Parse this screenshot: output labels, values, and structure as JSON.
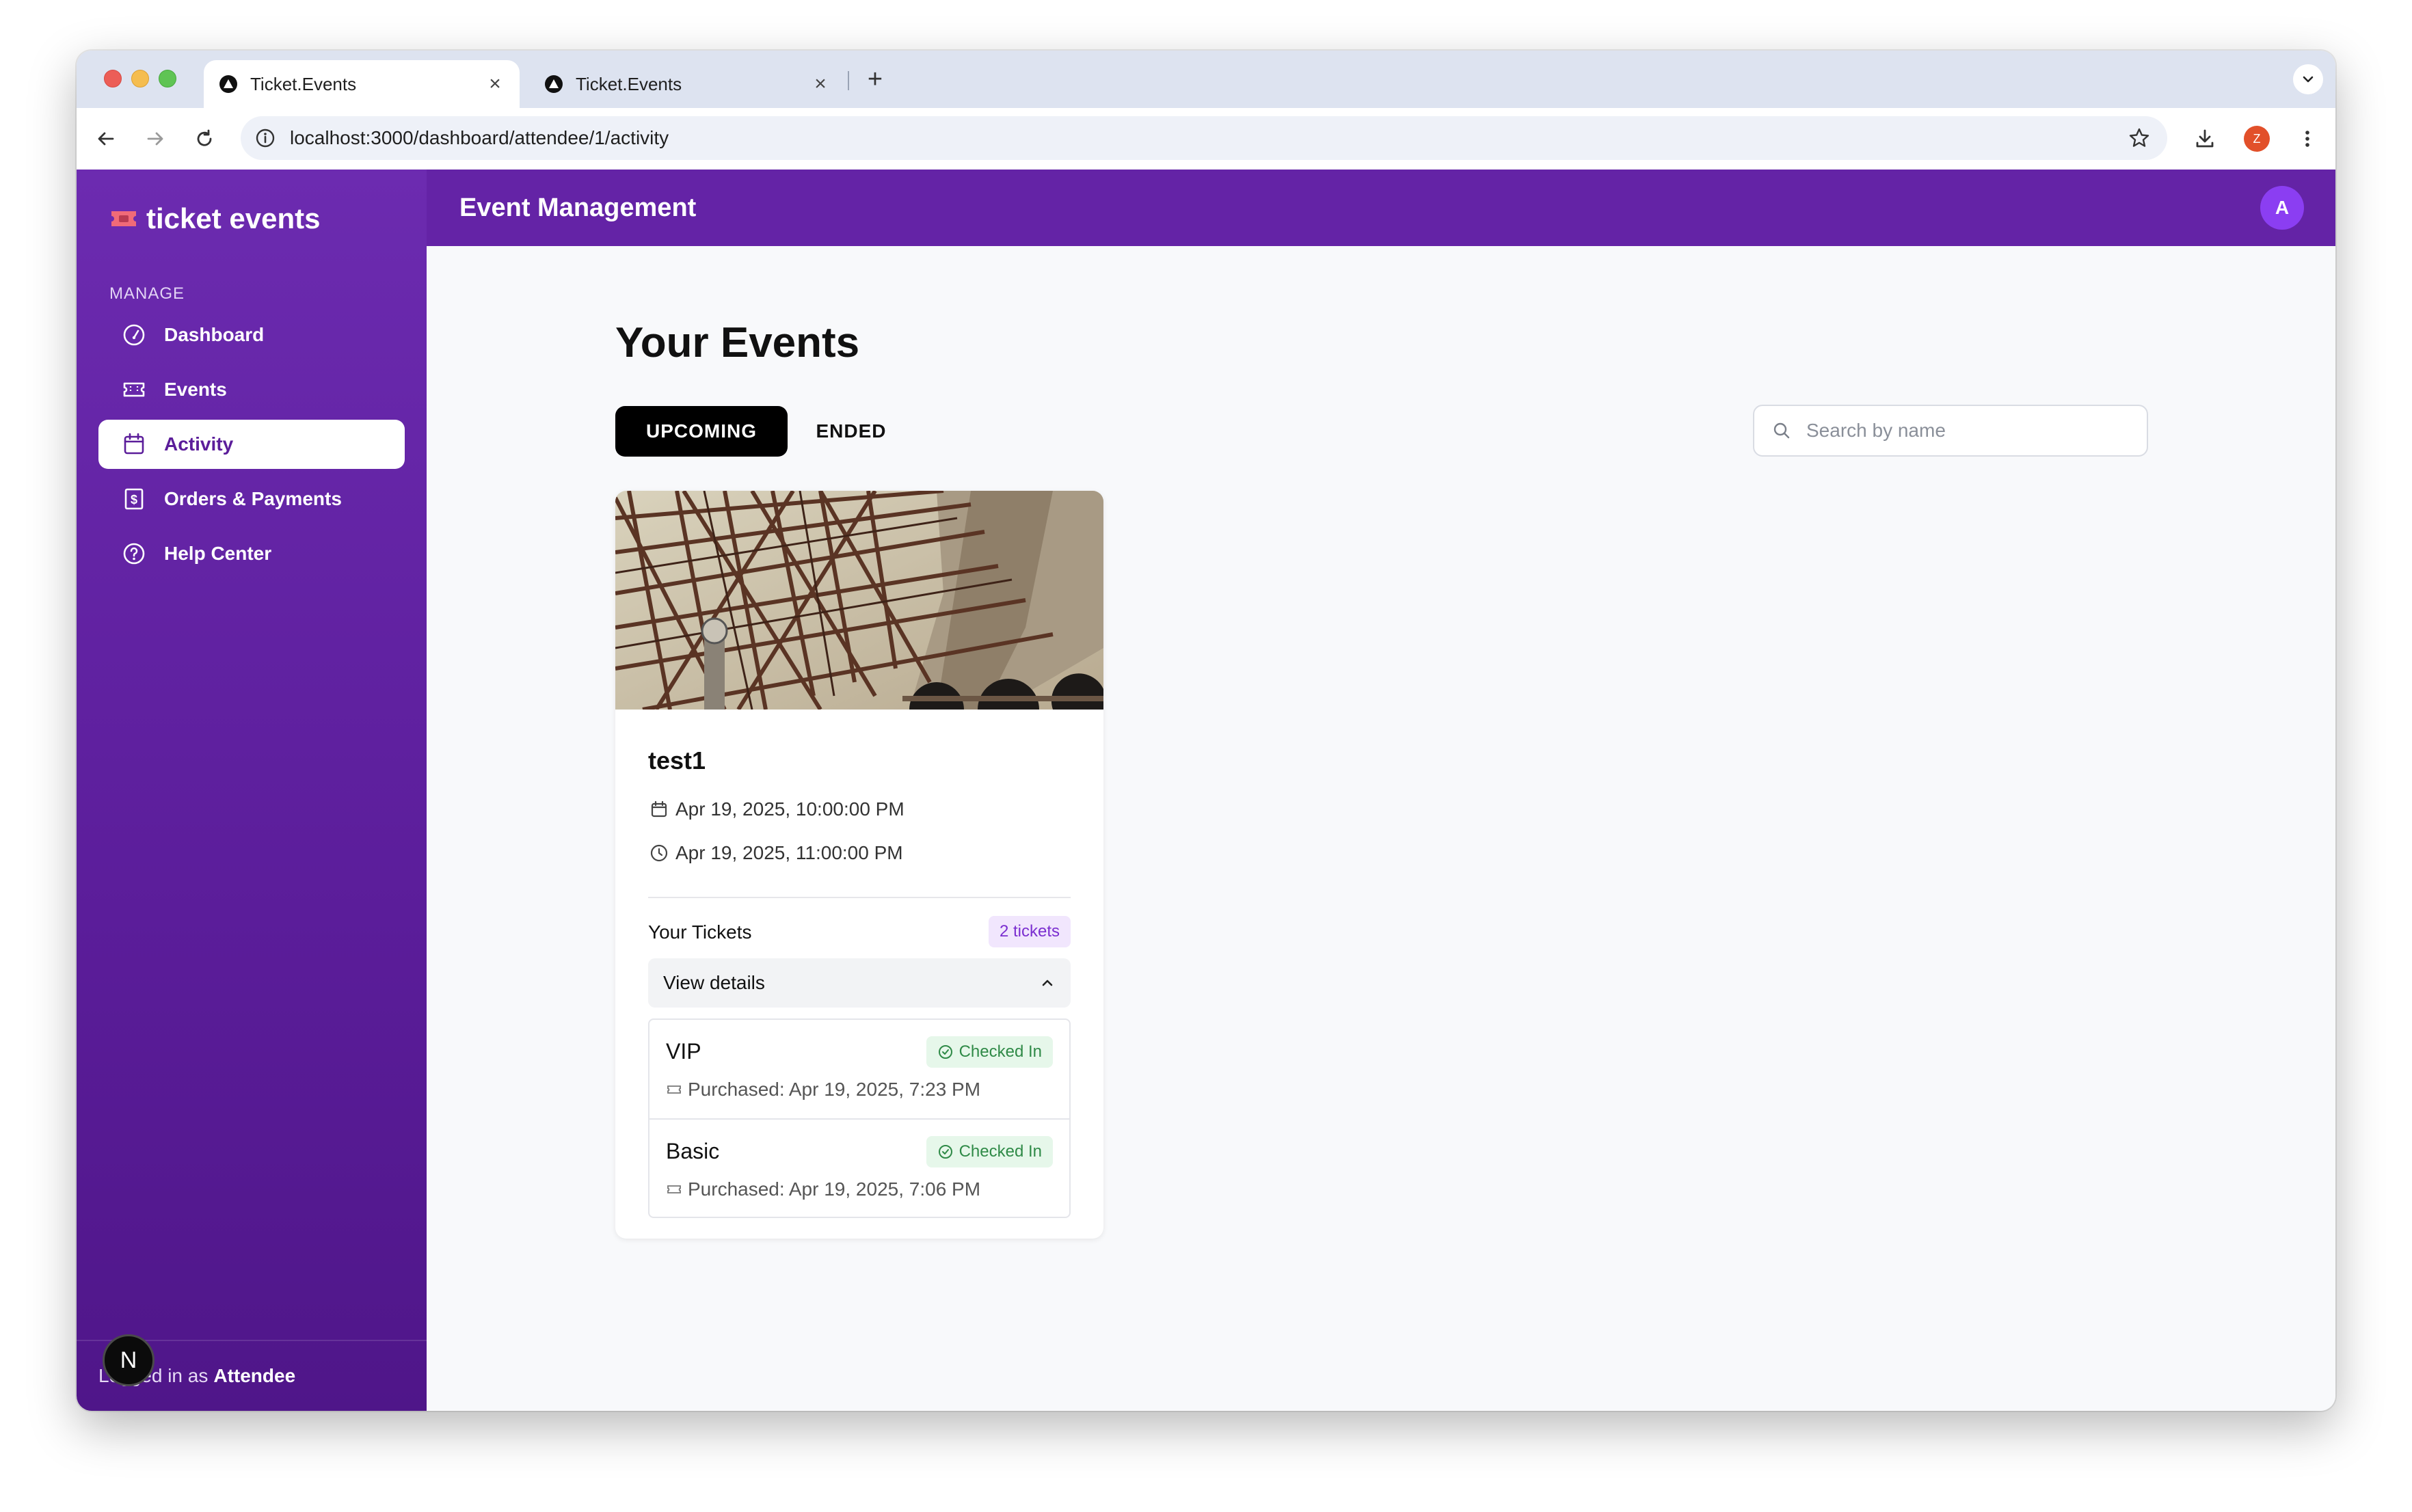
{
  "browser": {
    "tabs": [
      {
        "title": "Ticket.Events",
        "active": true
      },
      {
        "title": "Ticket.Events",
        "active": false
      }
    ],
    "url": "localhost:3000/dashboard/attendee/1/activity",
    "profile_initial": "Z"
  },
  "app": {
    "brand": "ticket events",
    "section_label": "MANAGE",
    "nav": [
      {
        "label": "Dashboard",
        "icon": "gauge-icon",
        "active": false
      },
      {
        "label": "Events",
        "icon": "ticket-icon",
        "active": false
      },
      {
        "label": "Activity",
        "icon": "calendar-icon",
        "active": true
      },
      {
        "label": "Orders & Payments",
        "icon": "dollar-receipt-icon",
        "active": false
      },
      {
        "label": "Help Center",
        "icon": "help-circle-icon",
        "active": false
      }
    ],
    "footer_prefix": "Logged in as",
    "footer_role": "Attendee",
    "next_badge": "N",
    "header_title": "Event Management",
    "avatar_initial": "A",
    "colors": {
      "sidebar": "#5b1d9a",
      "header": "#6423a6",
      "avatar": "#8b3ef2"
    }
  },
  "main": {
    "title": "Your Events",
    "tabs": {
      "upcoming": "UPCOMING",
      "ended": "ENDED"
    },
    "search_placeholder": "Search by name",
    "event": {
      "name": "test1",
      "start": "Apr 19, 2025, 10:00:00 PM",
      "end": "Apr 19, 2025, 11:00:00 PM",
      "tickets_label": "Your Tickets",
      "tickets_count": "2 tickets",
      "details_label": "View details",
      "tickets": [
        {
          "name": "VIP",
          "status": "Checked In",
          "purchased": "Purchased: Apr 19, 2025, 7:23 PM"
        },
        {
          "name": "Basic",
          "status": "Checked In",
          "purchased": "Purchased: Apr 19, 2025, 7:06 PM"
        }
      ]
    }
  }
}
